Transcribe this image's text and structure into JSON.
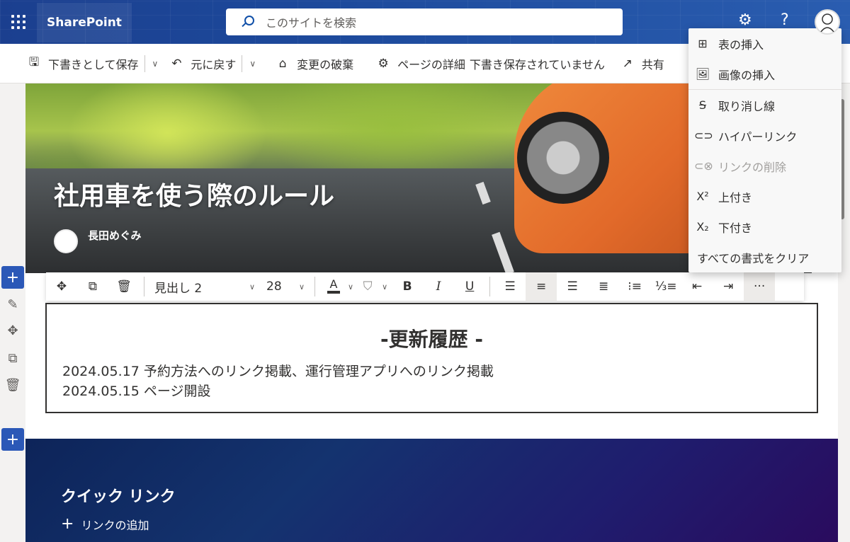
{
  "suitebar": {
    "brand": "SharePoint",
    "search_placeholder": "このサイトを検索",
    "settings_icon": "gear-icon",
    "help": "?",
    "help_icon": "help-icon"
  },
  "commandbar": {
    "save_draft": "下書きとして保存",
    "undo": "元に戻す",
    "discard": "変更の破棄",
    "page_details": "ページの詳細",
    "status": "下書き保存されていません",
    "share": "共有"
  },
  "hero": {
    "title": "社用車を使う際のルール",
    "author": "長田めぐみ"
  },
  "format_toolbar": {
    "style": "見出し 2",
    "font_size": "28",
    "bold": "B",
    "italic": "I",
    "underline": "U",
    "more": "···"
  },
  "textpart": {
    "heading": "-更新履歴 -",
    "lines": [
      "2024.05.17 予約方法へのリンク掲載、運行管理アプリへのリンク掲載",
      "2024.05.15 ページ開設"
    ]
  },
  "menu": {
    "items": [
      {
        "label": "表の挿入",
        "icon": "table-insert-icon",
        "disabled": false
      },
      {
        "label": "画像の挿入",
        "icon": "image-insert-icon",
        "disabled": false
      },
      {
        "label": "取り消し線",
        "icon": "strikethrough-icon",
        "disabled": false
      },
      {
        "label": "ハイパーリンク",
        "icon": "hyperlink-icon",
        "disabled": false
      },
      {
        "label": "リンクの削除",
        "icon": "remove-link-icon",
        "disabled": true
      },
      {
        "label": "上付き",
        "icon": "superscript-icon",
        "disabled": false
      },
      {
        "label": "下付き",
        "icon": "subscript-icon",
        "disabled": false
      },
      {
        "label": "すべての書式をクリア",
        "icon": "",
        "disabled": false
      }
    ]
  },
  "quicklinks": {
    "title": "クイック リンク",
    "add_link": "リンクの追加"
  },
  "colors": {
    "suitebar": "#1d4a9c",
    "accent": "#2b58b7",
    "quicklinks_bg": "#14336f"
  }
}
